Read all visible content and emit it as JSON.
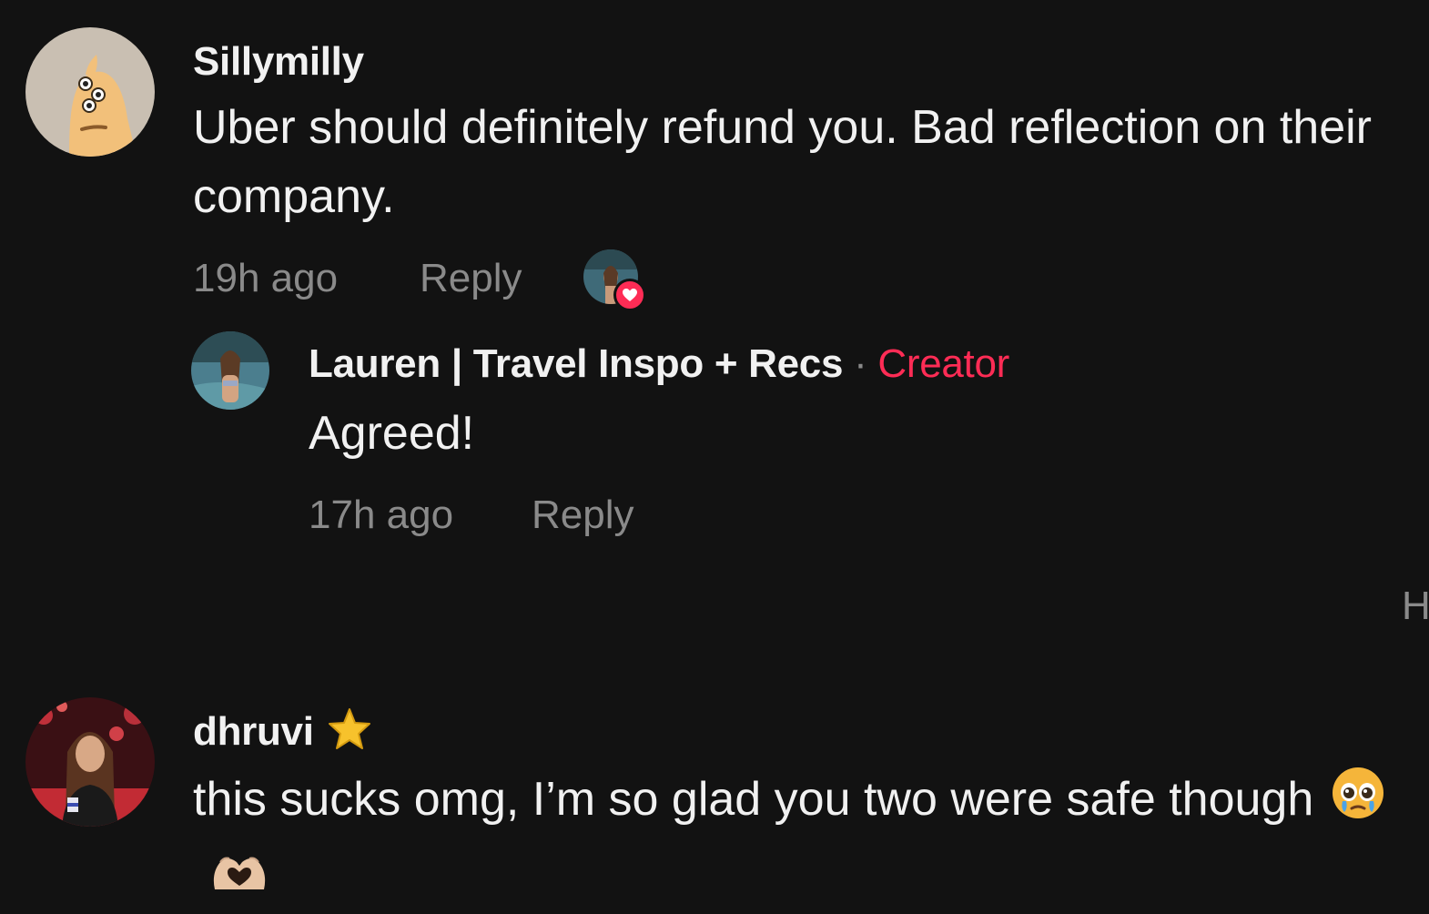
{
  "comments": [
    {
      "username": "Sillymilly",
      "text": "Uber should definitely refund you. Bad reflection on their company.",
      "time": "19h ago",
      "reply_label": "Reply",
      "liked_by_creator": true,
      "replies": [
        {
          "username": "Lauren | Travel Inspo + Recs",
          "separator": "·",
          "badge": "Creator",
          "text": "Agreed!",
          "time": "17h ago",
          "reply_label": "Reply"
        }
      ]
    },
    {
      "username": "dhruvi",
      "username_emoji": "star",
      "text": "this sucks omg, I’m so glad you two were safe though",
      "text_emojis": [
        "pleading-face",
        "heart-hands"
      ]
    }
  ],
  "hidden_control_char": "H",
  "colors": {
    "background": "#121212",
    "text": "#f1f1f1",
    "muted": "#8a8a8a",
    "creator_badge": "#fe2c55"
  }
}
